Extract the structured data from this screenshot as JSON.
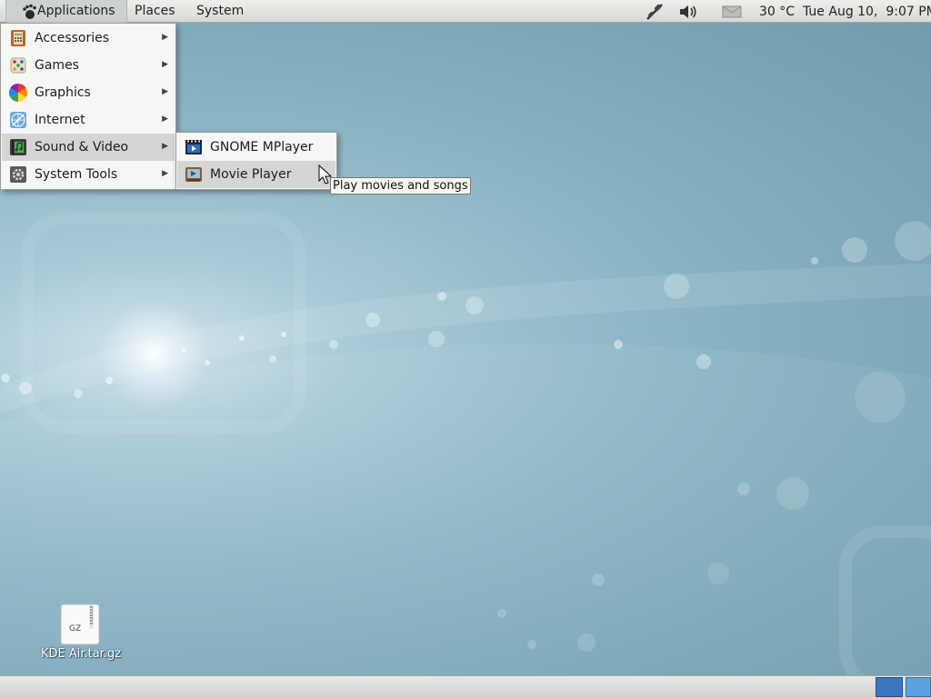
{
  "top_panel": {
    "menus": {
      "applications": "Applications",
      "places": "Places",
      "system": "System"
    },
    "tray": {
      "weather": "30 °C",
      "clock": "Tue Aug 10,  9:07 PM"
    },
    "icons": [
      "foot-icon",
      "network-icon",
      "volume-icon",
      "mail-icon"
    ]
  },
  "applications_menu": {
    "items": [
      {
        "label": "Accessories",
        "icon": "accessories-icon"
      },
      {
        "label": "Games",
        "icon": "games-icon"
      },
      {
        "label": "Graphics",
        "icon": "graphics-icon"
      },
      {
        "label": "Internet",
        "icon": "internet-icon"
      },
      {
        "label": "Sound & Video",
        "icon": "sound-video-icon",
        "highlighted": true
      },
      {
        "label": "System Tools",
        "icon": "system-tools-icon"
      }
    ]
  },
  "sound_video_submenu": {
    "items": [
      {
        "label": "GNOME MPlayer",
        "icon": "mplayer-icon"
      },
      {
        "label": "Movie Player",
        "icon": "movie-player-icon",
        "highlighted": true
      }
    ]
  },
  "tooltip": {
    "text": "Play movies and songs"
  },
  "desktop": {
    "icons": [
      {
        "label": "KDE Air.tar.gz",
        "badge": "GZ",
        "icon": "archive-file-icon"
      }
    ]
  },
  "bottom_panel": {
    "workspaces": [
      "active",
      "inactive"
    ]
  },
  "colors": {
    "accent": "#3a76c0",
    "menu_highlight": "#d3d6d3",
    "panel": "#e2e2e0"
  }
}
